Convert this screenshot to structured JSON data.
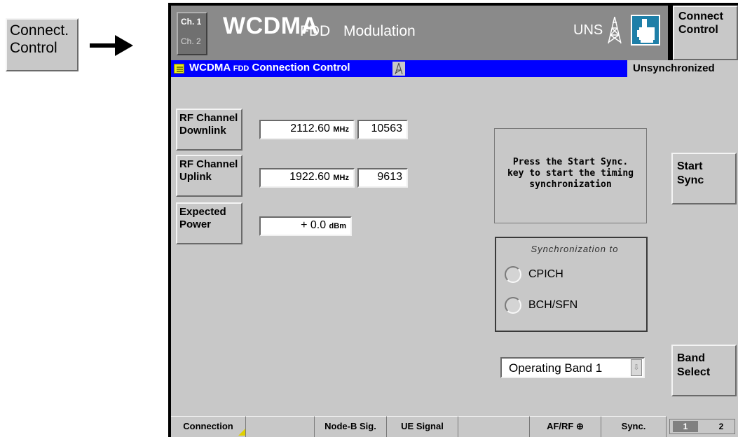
{
  "external_key": {
    "line1": "Connect.",
    "line2": "Control"
  },
  "title_bar": {
    "ch1": "Ch. 1",
    "ch2": "Ch. 2",
    "app": "WCDMA",
    "app_suffix": "FDD",
    "mode": "Modulation",
    "status": "UNS",
    "connect_control": {
      "line1": "Connect",
      "line2": "Control"
    }
  },
  "header": {
    "title_main": "WCDMA",
    "title_small": "FDD",
    "title_rest": "Connection Control",
    "status": "Unsynchronized"
  },
  "params": {
    "rf_downlink": {
      "line1": "RF Channel",
      "line2": "Downlink",
      "freq": "2112.60",
      "unit": "MHz",
      "channel": "10563"
    },
    "rf_uplink": {
      "line1": "RF Channel",
      "line2": "Uplink",
      "freq": "1922.60",
      "unit": "MHz",
      "channel": "9613"
    },
    "expected_power": {
      "line1": "Expected",
      "line2": "Power",
      "value": "+ 0.0",
      "unit": "dBm"
    }
  },
  "message": {
    "line1": "Press the Start Sync.",
    "line2": "key to start the timing",
    "line3": "synchronization"
  },
  "sync": {
    "title": "Synchronization to",
    "options": [
      {
        "label": "CPICH"
      },
      {
        "label": "BCH/SFN"
      }
    ]
  },
  "side_buttons": {
    "start_sync": {
      "line1": "Start",
      "line2": "Sync"
    },
    "band_select": {
      "line1": "Band",
      "line2": "Select"
    }
  },
  "band": {
    "value": "Operating Band 1"
  },
  "softkeys": [
    {
      "label": "Connection"
    },
    {
      "label": ""
    },
    {
      "label": "Node-B Sig."
    },
    {
      "label": "UE Signal"
    },
    {
      "label": ""
    },
    {
      "label": "AF/RF"
    },
    {
      "label": "Sync."
    }
  ],
  "pages": {
    "p1": "1",
    "p2": "2"
  },
  "colors": {
    "header_bg": "#0000ff",
    "title_bg": "#8a8a8a",
    "panel_bg": "#c8c8c8",
    "hand_btn": "#1e7fa8"
  }
}
